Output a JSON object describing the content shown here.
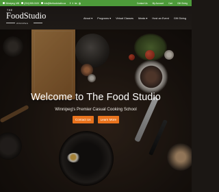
{
  "topbar": {
    "phone": "(204) 555-0100",
    "email": "info@thefoodstudio.ca",
    "address": "Winnipeg, MB",
    "social": [
      "f",
      "t",
      "in",
      "◎"
    ],
    "links": [
      "Contact Us",
      "My Account",
      "Cart",
      "Gift Giving"
    ]
  },
  "logo": {
    "the": "THE",
    "name": "FoodStudio",
    "tagline": "WINNIPEG"
  },
  "nav": {
    "items": [
      "About ▾",
      "Programs ▾",
      "Virtual Classes",
      "Meals ▾",
      "Host an Event",
      "Gift Giving"
    ]
  },
  "hero": {
    "title": "Welcome to The Food Studio",
    "subtitle": "Winnipeg's Premier Casual Cooking School",
    "contact_label": "Contact Us",
    "learn_label": "Learn More"
  },
  "colors": {
    "topbar": "#4d9a3a",
    "button": "#e8731e"
  }
}
